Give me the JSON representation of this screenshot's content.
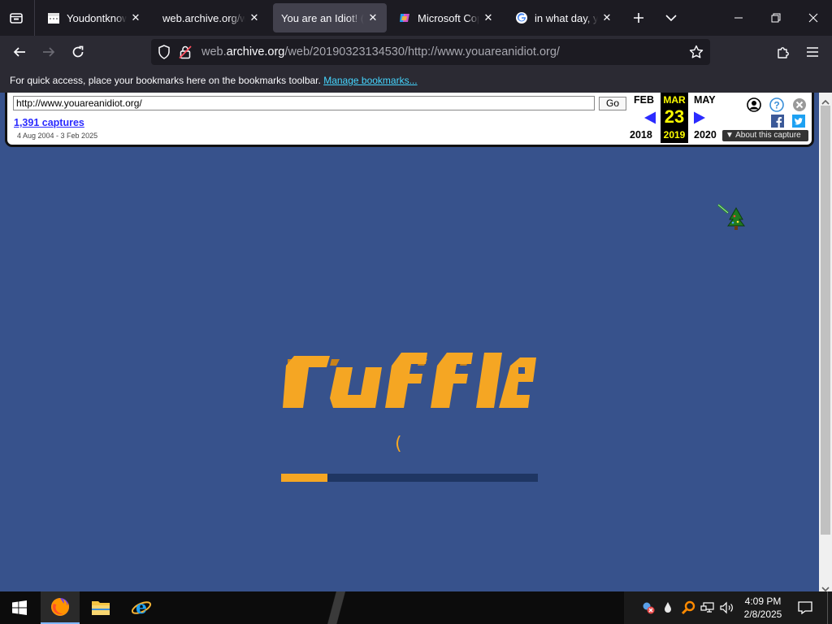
{
  "tabs": [
    {
      "title": "Youdontknowwho",
      "favicon": "calendar-icon",
      "active": false
    },
    {
      "title": "web.archive.org/web/",
      "favicon": "none",
      "active": false
    },
    {
      "title": "You are an Idiot! (do",
      "favicon": "none",
      "active": true
    },
    {
      "title": "Microsoft Copilot",
      "favicon": "copilot-icon",
      "active": false
    },
    {
      "title": "in what day, year",
      "favicon": "google-icon",
      "active": false
    }
  ],
  "nav": {
    "url_domain_prefix": "web.",
    "url_domain": "archive.org",
    "url_path": "/web/20190323134530/http://www.youareanidiot.org/"
  },
  "bookmarks_bar": {
    "message": "For quick access, place your bookmarks here on the bookmarks toolbar.",
    "link": "Manage bookmarks..."
  },
  "wayback": {
    "url_value": "http://www.youareanidiot.org/",
    "go_label": "Go",
    "captures": "1,391 captures",
    "range": "4 Aug 2004 - 3 Feb 2025",
    "prev_month": "FEB",
    "prev_year": "2018",
    "cur_month": "MAR",
    "cur_day": "23",
    "cur_year": "2019",
    "next_month": "MAY",
    "next_year": "2020",
    "about": "About this capture"
  },
  "ruffle": {
    "logo_text": "ruffle",
    "spinner": "(",
    "progress": 0.18,
    "brand_color": "#f5a623",
    "bg_color": "#37528c"
  },
  "taskbar": {
    "time": "4:09 PM",
    "date": "2/8/2025"
  }
}
